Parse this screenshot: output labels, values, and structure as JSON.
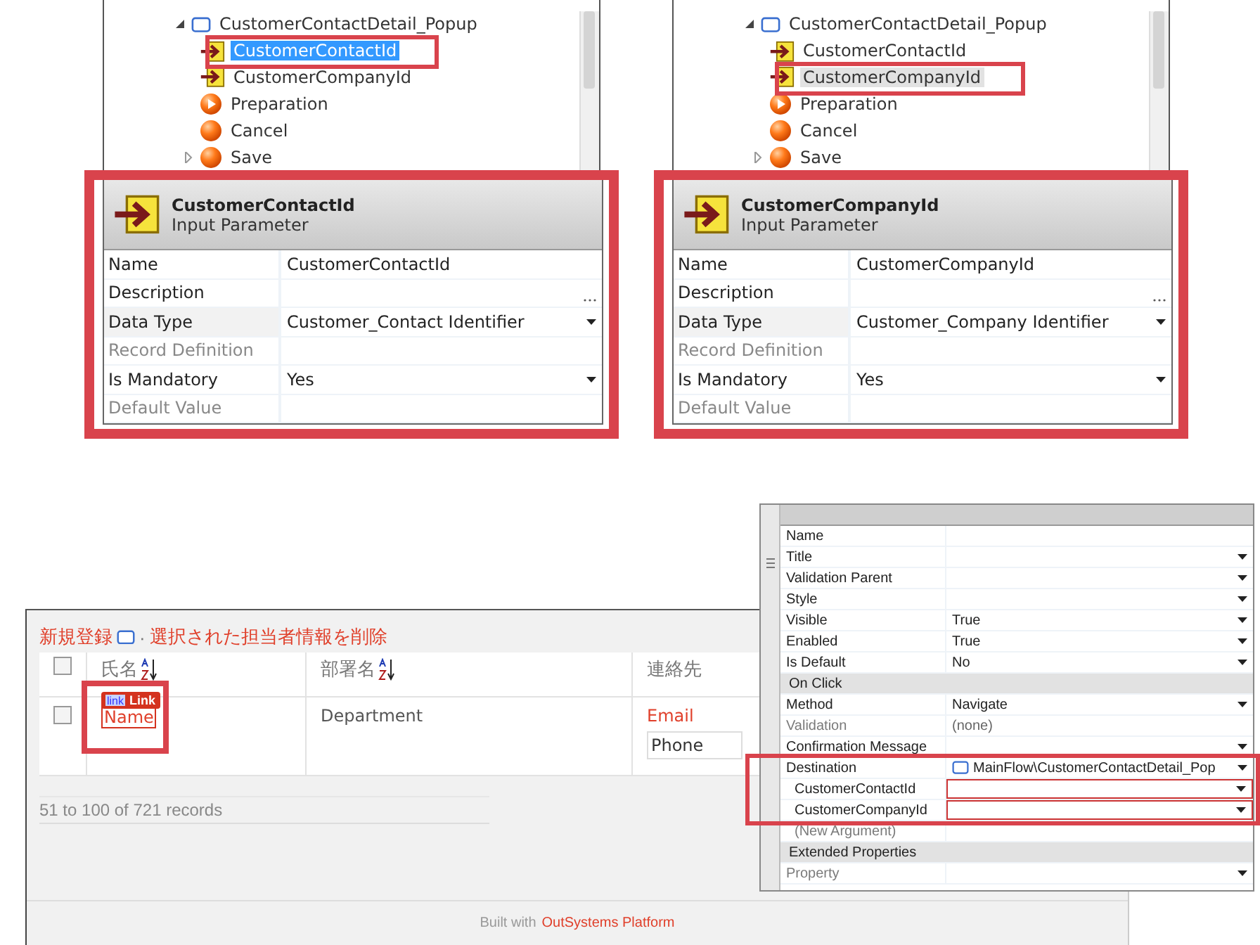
{
  "parameter_views": [
    {
      "tree": {
        "label": "CustomerContactDetail_Popup",
        "expanded": true,
        "focused": true,
        "children": [
          {
            "label": "CustomerContactId",
            "kind": "parameter",
            "selected": true,
            "expandable": false
          },
          {
            "label": "CustomerCompanyId",
            "kind": "parameter",
            "selected": false,
            "expandable": false
          },
          {
            "label": "Preparation",
            "kind": "preparation",
            "selected": false,
            "expandable": false
          },
          {
            "label": "Cancel",
            "kind": "action",
            "selected": false,
            "expandable": false
          },
          {
            "label": "Save",
            "kind": "action",
            "selected": false,
            "expandable": true
          }
        ]
      },
      "header": {
        "title": "CustomerContactId",
        "subtitle": "Input Parameter"
      },
      "properties": [
        {
          "label": "Name",
          "value": "CustomerContactId",
          "kind": "text",
          "disabled": false
        },
        {
          "label": "Description",
          "kind": "ellipsis",
          "disabled": false
        },
        {
          "label": "Data Type",
          "value": "Customer_Contact Identifier",
          "kind": "dropdown",
          "disabled": false
        },
        {
          "label": "Record Definition",
          "kind": "text",
          "disabled": true
        },
        {
          "label": "Is Mandatory",
          "value": "Yes",
          "kind": "dropdown",
          "disabled": false
        },
        {
          "label": "Default Value",
          "kind": "text",
          "disabled": true
        }
      ]
    },
    {
      "tree": {
        "label": "CustomerContactDetail_Popup",
        "expanded": true,
        "focused": false,
        "children": [
          {
            "label": "CustomerContactId",
            "kind": "parameter",
            "selected": false,
            "expandable": false
          },
          {
            "label": "CustomerCompanyId",
            "kind": "parameter",
            "selected": true,
            "expandable": false
          },
          {
            "label": "Preparation",
            "kind": "preparation",
            "selected": false,
            "expandable": false
          },
          {
            "label": "Cancel",
            "kind": "action",
            "selected": false,
            "expandable": false
          },
          {
            "label": "Save",
            "kind": "action",
            "selected": false,
            "expandable": true
          }
        ]
      },
      "header": {
        "title": "CustomerCompanyId",
        "subtitle": "Input Parameter"
      },
      "properties": [
        {
          "label": "Name",
          "value": "CustomerCompanyId",
          "kind": "text",
          "disabled": false
        },
        {
          "label": "Description",
          "kind": "ellipsis",
          "disabled": false
        },
        {
          "label": "Data Type",
          "value": "Customer_Company Identifier",
          "kind": "dropdown",
          "disabled": false
        },
        {
          "label": "Record Definition",
          "kind": "text",
          "disabled": true
        },
        {
          "label": "Is Mandatory",
          "value": "Yes",
          "kind": "dropdown",
          "disabled": false
        },
        {
          "label": "Default Value",
          "kind": "text",
          "disabled": true
        }
      ]
    }
  ],
  "web_page": {
    "actions": {
      "new_link": "新規登録",
      "separator": "·",
      "delete_link": "選択された担当者情報を削除"
    },
    "table": {
      "header_checked": false,
      "columns": [
        {
          "label": "氏名",
          "sortable": true
        },
        {
          "label": "部署名",
          "sortable": true
        },
        {
          "label": "連絡先",
          "sortable": false
        }
      ],
      "widget_badge": {
        "icon_text": "link",
        "label": "Link"
      },
      "rows": [
        {
          "checked": false,
          "name": "Name",
          "department": "Department",
          "email": "Email",
          "phone": "Phone"
        }
      ]
    },
    "record_count": "51 to 100 of 721 records",
    "footer": {
      "prefix": "Built with",
      "link": "OutSystems Platform"
    }
  },
  "properties_panel": {
    "rows": [
      {
        "kind": "property",
        "label": "Name",
        "dropdown": false,
        "disabled": false
      },
      {
        "kind": "property",
        "label": "Title",
        "dropdown": true,
        "disabled": false
      },
      {
        "kind": "property",
        "label": "Validation Parent",
        "dropdown": true,
        "disabled": false
      },
      {
        "kind": "property",
        "label": "Style",
        "dropdown": true,
        "disabled": false
      },
      {
        "kind": "property",
        "label": "Visible",
        "value": "True",
        "dropdown": true,
        "disabled": false
      },
      {
        "kind": "property",
        "label": "Enabled",
        "value": "True",
        "dropdown": true,
        "disabled": false
      },
      {
        "kind": "property",
        "label": "Is Default",
        "value": "No",
        "dropdown": true,
        "disabled": false
      },
      {
        "kind": "section",
        "label": "On Click"
      },
      {
        "kind": "property",
        "label": "Method",
        "value": "Navigate",
        "dropdown": true,
        "disabled": false
      },
      {
        "kind": "property",
        "label": "Validation",
        "value": "(none)",
        "dropdown": false,
        "disabled": true
      },
      {
        "kind": "property",
        "label": "Confirmation Message",
        "dropdown": true,
        "disabled": false
      },
      {
        "kind": "destination",
        "label": "Destination",
        "value": "MainFlow\\CustomerContactDetail_Pop",
        "dropdown": true,
        "disabled": false
      },
      {
        "kind": "argument",
        "label": "CustomerContactId",
        "dropdown": true,
        "error": true,
        "disabled": false
      },
      {
        "kind": "argument",
        "label": "CustomerCompanyId",
        "dropdown": true,
        "error": true,
        "disabled": false
      },
      {
        "kind": "argument",
        "label": "(New Argument)",
        "dropdown": false,
        "error": false,
        "disabled": true
      },
      {
        "kind": "section",
        "label": "Extended Properties"
      },
      {
        "kind": "property",
        "label": "Property",
        "dropdown": true,
        "disabled": true
      }
    ]
  }
}
